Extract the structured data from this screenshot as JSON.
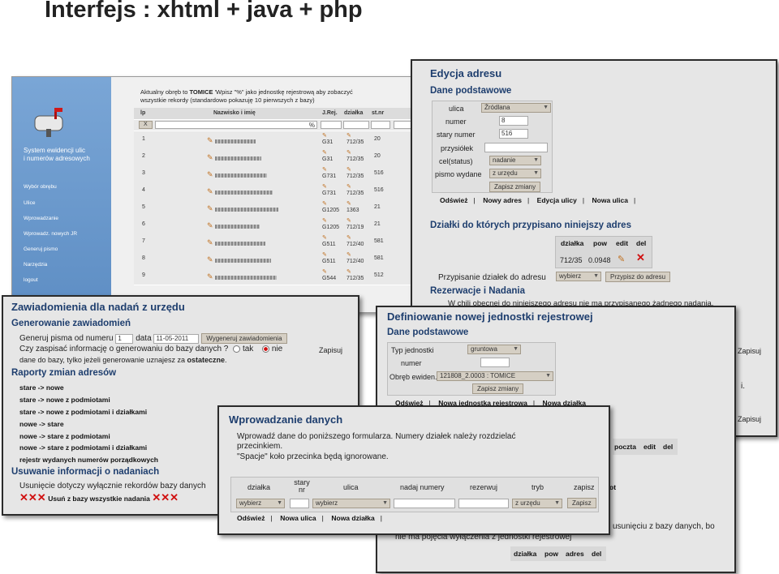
{
  "slide_title": "Interfejs : xhtml + java + php",
  "bg_window": {
    "logo_text_1": "System ewidencji ulic",
    "logo_text_2": "i numerów adresowych",
    "menu": [
      "Wybór obrębu",
      "Ulice",
      "Wprowadzanie",
      "Wprowadz. nowych JR",
      "Generuj pismo",
      "Narzędzia",
      "logout"
    ],
    "notice_1_pre": "Aktualny obręb to",
    "notice_1_bold": "TOMICE",
    "notice_1_post": "'Wpisz \"%\" jako jednostkę rejestrową aby zobaczyć",
    "notice_2": "wszystkie rekordy (standardowo pokazuję 10 pierwszych z bazy)",
    "headers": [
      "lp",
      "Nazwisko i imię",
      "J.Rej.",
      "działka",
      "st.nr"
    ],
    "filter_x": "X",
    "filter_pct": "%",
    "rows": [
      {
        "lp": "1",
        "jr": "G31",
        "dz": "712/35",
        "st": "20"
      },
      {
        "lp": "2",
        "jr": "G31",
        "dz": "712/35",
        "st": "20"
      },
      {
        "lp": "3",
        "jr": "G731",
        "dz": "712/35",
        "st": "516"
      },
      {
        "lp": "4",
        "jr": "G731",
        "dz": "712/35",
        "st": "516"
      },
      {
        "lp": "5",
        "jr": "G1205",
        "dz": "1363",
        "st": "21"
      },
      {
        "lp": "6",
        "jr": "G1205",
        "dz": "712/19",
        "st": "21"
      },
      {
        "lp": "7",
        "jr": "G511",
        "dz": "712/40",
        "st": "581"
      },
      {
        "lp": "8",
        "jr": "G511",
        "dz": "712/40",
        "st": "581"
      },
      {
        "lp": "9",
        "jr": "G544",
        "dz": "712/35",
        "st": "512"
      }
    ]
  },
  "edycja": {
    "title": "Edycja adresu",
    "section": "Dane podstawowe",
    "fields": {
      "ulica_label": "ulica",
      "ulica_value": "Źródlana",
      "numer_label": "numer",
      "numer_value": "8",
      "stary_label": "stary numer",
      "stary_value": "516",
      "przysiolek_label": "przysiółek",
      "przysiolek_value": "",
      "cel_label": "cel(status)",
      "cel_value": "nadanie",
      "pismo_label": "pismo wydane",
      "pismo_value": "z urzędu"
    },
    "save_button": "Zapisz zmiany",
    "links": [
      "Odśwież",
      "Nowy adres",
      "Edycja ulicy",
      "Nowa ulica"
    ],
    "dzialki_title": "Działki do których przypisano niniejszy adres",
    "dz_headers": [
      "działka",
      "pow",
      "edit",
      "del"
    ],
    "dz_row": {
      "dzialka": "712/35",
      "pow": "0.0948"
    },
    "assign_label": "Przypisanie działek do adresu",
    "assign_select": "wybierz",
    "assign_button": "Przypisz do adresu",
    "rez_title": "Rezerwacje i Nadania",
    "rez_text": "W chili obecnej do niniejszego adresu nie ma przypisanego żadnego nadania.",
    "zapisuj_1": "Zapisuj",
    "zapisuj_2": "Zapisuj",
    "frag_i": "i."
  },
  "zawiadomienia": {
    "title": "Zawiadomienia dla nadań z urzędu",
    "gen_title": "Generowanie zawiadomień",
    "gen_line_label": "Generuj pisma od numeru",
    "gen_number": "1",
    "data_label": "data",
    "data_value": "11-05-2011",
    "gen_button": "Wygeneruj zawiadomienia",
    "q_line": "Czy zaspisać informację o generowaniu do bazy danych ?",
    "opt_tak": "tak",
    "opt_nie": "nie",
    "zapisuj": "Zapisuj",
    "q_note_pre": "dane do bazy, tylko jeżeli generowanie uznajesz za",
    "q_note_bold": "ostateczne",
    "q_note_end": ".",
    "rap_title": "Raporty zmian adresów",
    "reports": [
      "stare -> nowe",
      "stare -> nowe z podmiotami",
      "stare -> nowe z podmiotami i działkami",
      "nowe -> stare",
      "nowe -> stare z podmiotami",
      "nowe -> stare z podmiotami i działkami",
      "rejestr wydanych numerów porządkowych"
    ],
    "usun_title": "Usuwanie informacji o nadaniach",
    "usun_text": "Usunięcie dotyczy wyłącznie rekordów bazy danych",
    "usun_button": "Usuń z bazy wszystkie nadania"
  },
  "definiowanie": {
    "title": "Definiowanie nowej jednostki rejestrowej",
    "section": "Dane podstawowe",
    "typ_label": "Typ jednostki",
    "typ_value": "gruntowa",
    "numer_label": "numer",
    "numer_value": "",
    "obreb_label": "Obręb ewiden.",
    "obreb_value": "121808_2.0003 : TOMICE",
    "save_button": "Zapisz zmiany",
    "links": [
      "Odśwież",
      "Nowa jednostka rejestrowa",
      "Nowa działka"
    ],
    "frag_headers": [
      "poczta",
      "edit",
      "del"
    ],
    "frag_ot": "ot",
    "frag_text_1": "usunięciu z bazy danych, bo",
    "frag_text_2": "nie ma pojęcia wyłączenia z jednostki rejestrowej",
    "bottom_headers": [
      "działka",
      "pow",
      "adres",
      "del"
    ]
  },
  "wprowadzanie": {
    "title": "Wprowadzanie danych",
    "text_1": "Wprowadź dane do poniższego formularza. Numery działek należy rozdzielać",
    "text_2": "przecinkiem.",
    "text_3": "\"Spacje\" koło przecinka będą ignorowane.",
    "headers": [
      "działka",
      "stary nr",
      "ulica",
      "nadaj numery",
      "rezerwuj",
      "tryb",
      "zapisz"
    ],
    "dz_select": "wybierz",
    "ulica_select": "wybierz",
    "tryb_select": "z urzędu",
    "save_button": "Zapisz",
    "links": [
      "Odśwież",
      "Nowa ulica",
      "Nowa działka"
    ]
  }
}
